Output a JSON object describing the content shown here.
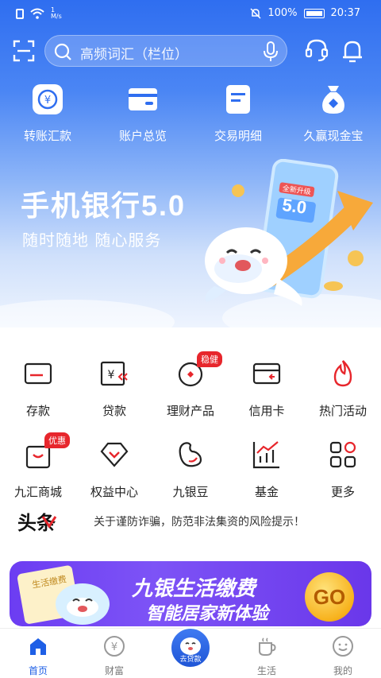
{
  "status_bar": {
    "network_speed": "1\nM/s",
    "battery": "100%",
    "time": "20:37"
  },
  "search": {
    "placeholder": "高频词汇（栏位）"
  },
  "quick_actions": [
    {
      "label": "转账汇款",
      "icon": "transfer-icon"
    },
    {
      "label": "账户总览",
      "icon": "wallet-icon"
    },
    {
      "label": "交易明细",
      "icon": "document-icon"
    },
    {
      "label": "久赢现金宝",
      "icon": "money-bag-icon"
    }
  ],
  "banner": {
    "title": "手机银行5.0",
    "subtitle": "随时随地 随心服务",
    "phone_text": "5.0",
    "badge": "全新升级"
  },
  "services_row1": [
    {
      "label": "存款",
      "icon": "deposit-icon"
    },
    {
      "label": "贷款",
      "icon": "loan-icon"
    },
    {
      "label": "理财产品",
      "icon": "wealth-icon",
      "tag": "稳健"
    },
    {
      "label": "信用卡",
      "icon": "credit-card-icon"
    },
    {
      "label": "热门活动",
      "icon": "flame-icon"
    }
  ],
  "services_row2": [
    {
      "label": "九汇商城",
      "icon": "shopping-bag-icon",
      "tag": "优惠"
    },
    {
      "label": "权益中心",
      "icon": "diamond-icon"
    },
    {
      "label": "九银豆",
      "icon": "bean-icon"
    },
    {
      "label": "基金",
      "icon": "chart-icon"
    },
    {
      "label": "更多",
      "icon": "grid-icon"
    }
  ],
  "headline": {
    "logo": "头条",
    "text": "关于谨防诈骗，防范非法集资的风险提示！"
  },
  "ad": {
    "title": "九银生活缴费",
    "subtitle": "智能居家新体验",
    "button": "GO",
    "tag": "生活缴费"
  },
  "tabs": [
    {
      "label": "首页",
      "icon": "home-icon",
      "active": true
    },
    {
      "label": "财富",
      "icon": "yen-icon"
    },
    {
      "label": "去贷款",
      "icon": "mascot-icon"
    },
    {
      "label": "生活",
      "icon": "cup-icon"
    },
    {
      "label": "我的",
      "icon": "smile-icon"
    }
  ],
  "colors": {
    "primary": "#2f6ef0",
    "accent_red": "#e7262c",
    "tab_active": "#1e5fe6"
  }
}
